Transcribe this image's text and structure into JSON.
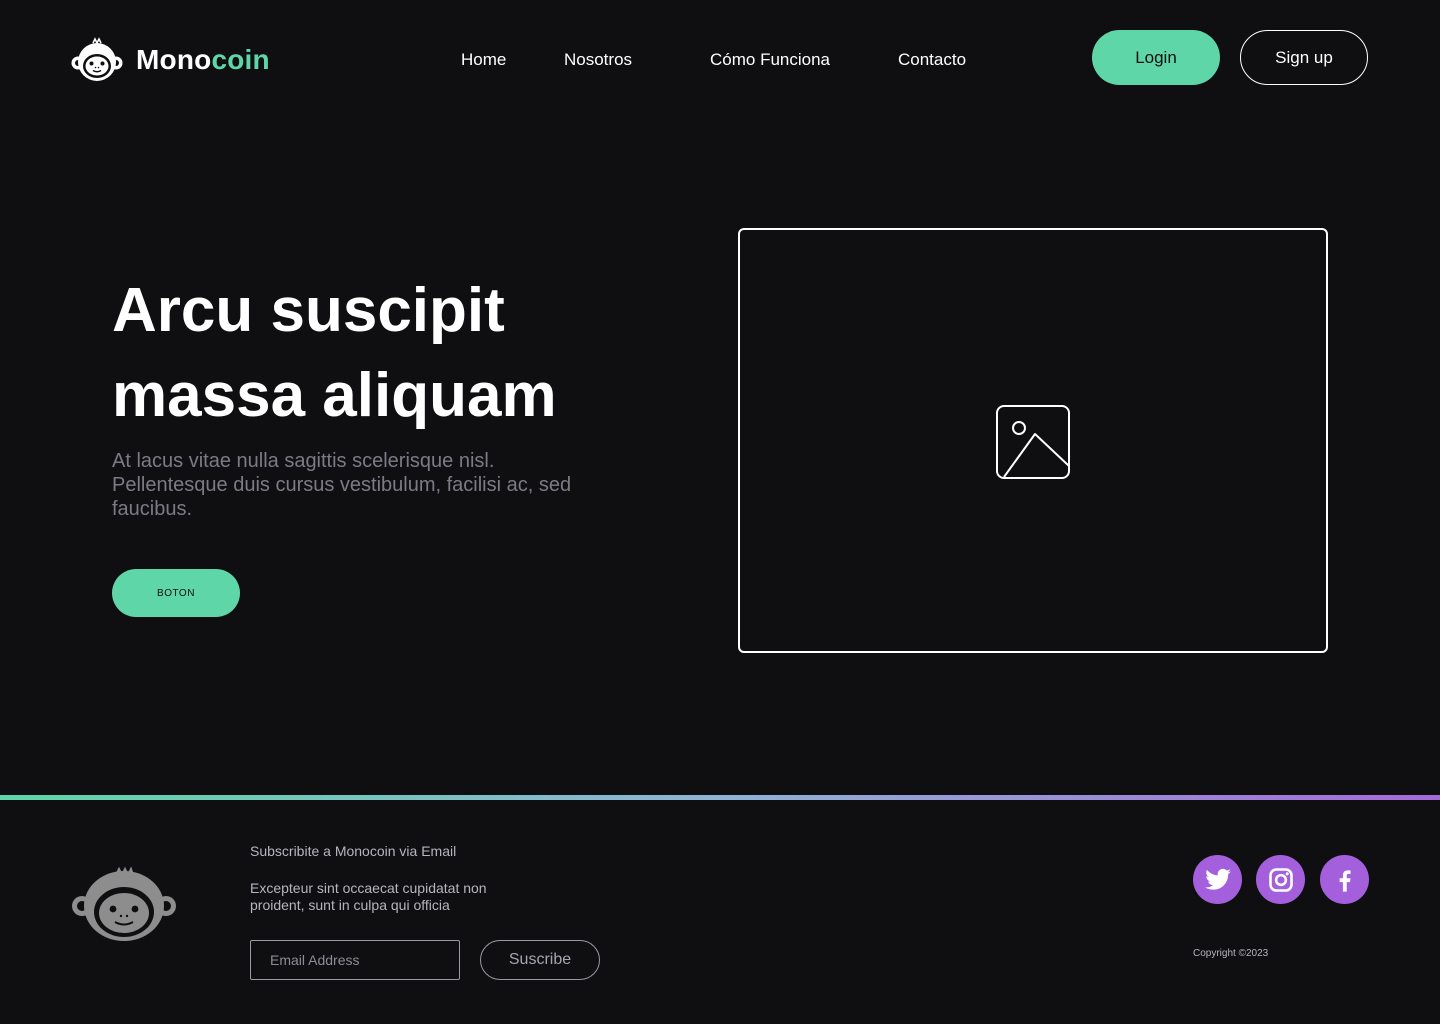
{
  "brand": {
    "name_part1": "Mono",
    "name_part2": "coin",
    "accent_color": "#5fd6a7",
    "logo_icon": "monkey-face-icon"
  },
  "nav": {
    "items": [
      {
        "label": "Home"
      },
      {
        "label": "Nosotros"
      },
      {
        "label": "Cómo Funciona"
      },
      {
        "label": "Contacto"
      }
    ],
    "login_label": "Login",
    "signup_label": "Sign up"
  },
  "hero": {
    "title_line1": "Arcu suscipit",
    "title_line2": "massa aliquam",
    "description": "At lacus vitae nulla sagittis scelerisque nisl. Pellentesque duis cursus vestibulum, facilisi ac, sed faucibus.",
    "button_label": "BOTON",
    "image_icon": "image-placeholder-icon"
  },
  "divider": {
    "gradient_colors": [
      "#5fd6a7",
      "#a56ad8"
    ]
  },
  "footer": {
    "subscribe_title": "Subscribite a Monocoin via Email",
    "subscribe_description": "Excepteur sint occaecat cupidatat non proident, sunt in culpa qui officia",
    "email_placeholder": "Email Address",
    "subscribe_button_label": "Suscribe",
    "social_color": "#a35fdc",
    "social_icons": [
      "twitter-icon",
      "instagram-icon",
      "facebook-icon"
    ],
    "copyright": "Copyright ©2023"
  }
}
